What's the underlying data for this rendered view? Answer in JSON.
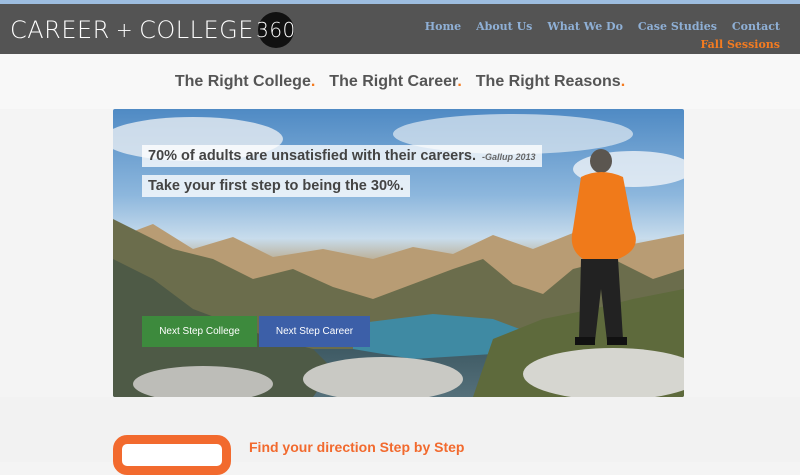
{
  "header": {
    "logo": {
      "career": "CAREER",
      "plus": "+",
      "college": "COLLEGE",
      "number": "360"
    },
    "nav": [
      "Home",
      "About Us",
      "What We Do",
      "Case Studies",
      "Contact"
    ],
    "fall_sessions": "Fall Sessions"
  },
  "tagline": {
    "items": [
      "The Right College",
      "The Right Career",
      "The Right Reasons"
    ],
    "dot": "."
  },
  "hero": {
    "quote": "70% of adults are unsatisfied with their careers.",
    "source": "-Gallup 2013",
    "subline": "Take your first step to being the 30%.",
    "buttons": {
      "college": "Next Step College",
      "career": "Next Step Career"
    }
  },
  "section": {
    "heading": "Find your direction Step by Step"
  },
  "colors": {
    "accent": "#f47b20",
    "nav": "#8fb0d6",
    "header_bg": "#545454",
    "college_btn": "#3d8a3d",
    "career_btn": "#3c5fa8"
  }
}
